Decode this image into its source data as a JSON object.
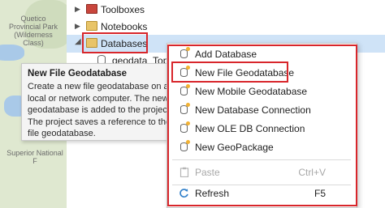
{
  "map": {
    "label_top": "Quetico Provincial Park (Wilderness Class)",
    "label_bottom": "Superior National F"
  },
  "tree": {
    "items": [
      {
        "label": "Toolboxes"
      },
      {
        "label": "Notebooks"
      },
      {
        "label": "Databases"
      },
      {
        "label": "geodata_Topo.gdb"
      }
    ]
  },
  "tooltip": {
    "title": "New File Geodatabase",
    "body": "Create a new file geodatabase on a local or network computer. The new geodatabase is added to the project. The project saves a reference to the file geodatabase."
  },
  "menu": {
    "items": [
      {
        "label": "Add Database",
        "icon": "database-add-icon"
      },
      {
        "label": "New File Geodatabase",
        "icon": "file-geodatabase-icon"
      },
      {
        "label": "New Mobile Geodatabase",
        "icon": "mobile-geodatabase-icon"
      },
      {
        "label": "New Database Connection",
        "icon": "database-connection-icon"
      },
      {
        "label": "New OLE DB Connection",
        "icon": "ole-db-icon"
      },
      {
        "label": "New GeoPackage",
        "icon": "geopackage-icon"
      },
      {
        "label": "Paste",
        "shortcut": "Ctrl+V",
        "icon": "paste-icon",
        "disabled": true
      },
      {
        "label": "Refresh",
        "shortcut": "F5",
        "icon": "refresh-icon"
      }
    ]
  },
  "colors": {
    "highlight": "#d8262b",
    "selection": "#cfe3f7",
    "refresh": "#2f7fc9"
  }
}
